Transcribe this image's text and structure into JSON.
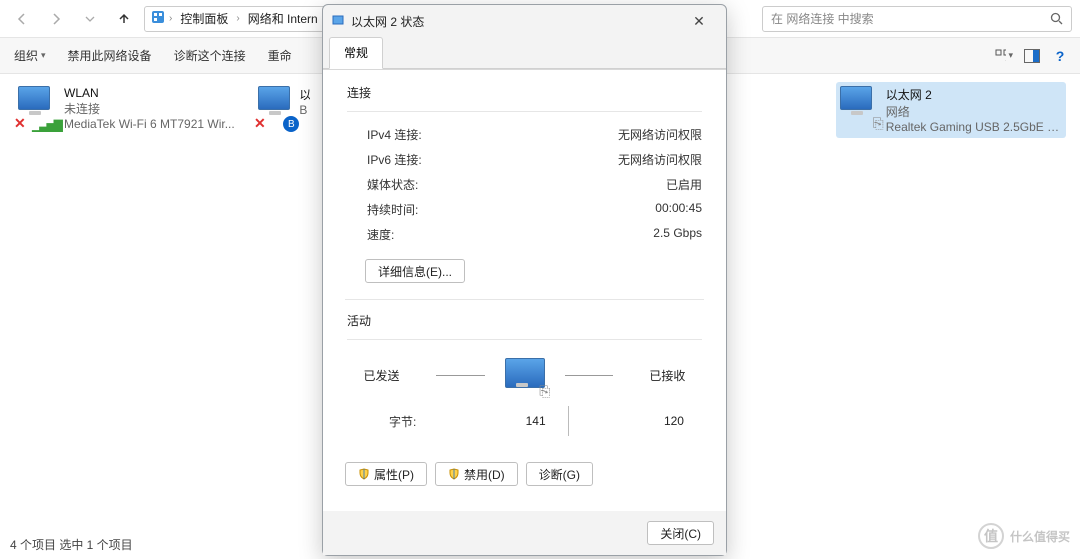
{
  "nav": {
    "crumb1": "控制面板",
    "crumb2": "网络和 Intern",
    "search_placeholder": "在 网络连接 中搜索"
  },
  "toolbar": {
    "organize": "组织",
    "disable_device": "禁用此网络设备",
    "diagnose": "诊断这个连接",
    "rename": "重命"
  },
  "connections": {
    "wlan": {
      "name": "WLAN",
      "status": "未连接",
      "adapter": "MediaTek Wi-Fi 6 MT7921 Wir..."
    },
    "bt": {
      "name": "以",
      "status": "",
      "adapter": "B"
    },
    "eth2": {
      "name": "以太网 2",
      "status": "网络",
      "adapter": "Realtek Gaming USB 2.5GbE F..."
    }
  },
  "dialog": {
    "title": "以太网 2 状态",
    "tab_general": "常规",
    "section_connect": "连接",
    "ipv4_label": "IPv4 连接:",
    "ipv4_value": "无网络访问权限",
    "ipv6_label": "IPv6 连接:",
    "ipv6_value": "无网络访问权限",
    "media_label": "媒体状态:",
    "media_value": "已启用",
    "duration_label": "持续时间:",
    "duration_value": "00:00:45",
    "speed_label": "速度:",
    "speed_value": "2.5 Gbps",
    "details_btn": "详细信息(E)...",
    "section_activity": "活动",
    "sent_label": "已发送",
    "recv_label": "已接收",
    "bytes_label": "字节:",
    "bytes_sent": "141",
    "bytes_recv": "120",
    "properties_btn": "属性(P)",
    "disable_btn": "禁用(D)",
    "diagnose_btn": "诊断(G)",
    "close_btn": "关闭(C)"
  },
  "statusbar": "4 个项目    选中 1 个项目",
  "watermark": "什么值得买"
}
